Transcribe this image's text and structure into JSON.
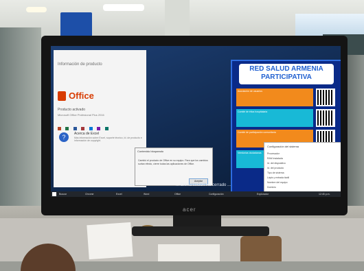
{
  "monitor": {
    "brand": "acer"
  },
  "office_window": {
    "heading": "Información de producto",
    "brand": "Office",
    "activated": "Producto activado",
    "product_name": "Microsoft Office Profesional Plus 2016",
    "about_title": "Acerca de Excel",
    "about_text": "Más información sobre Excel, soporte técnico, Id. de producto e información de copyright."
  },
  "dialog": {
    "title": "Contenido bloqueado",
    "body": "Cambió el producto de Office en su equipo. Para que los cambios surtan efecto, cierre todas las aplicaciones de Office.",
    "button": "Aceptar"
  },
  "desktop_text": "... Cierra sesión Ha cerrado ...",
  "poster": {
    "title_line1": "RED SALUD ARMENIA",
    "title_line2": "PARTICIPATIVA",
    "rows": [
      {
        "color": "#f28a1c",
        "text": "Asociación de usuarios"
      },
      {
        "color": "#18b9d6",
        "text": "Comité de ética hospitalaria"
      },
      {
        "color": "#f28a1c",
        "text": "Comité de participación comunitaria"
      },
      {
        "color": "#18b9d6",
        "text": "Veedurías ciudadanas"
      }
    ]
  },
  "info_window": {
    "title": "Configuración del sistema",
    "rows": [
      "Procesador",
      "RAM instalada",
      "Id. del dispositivo",
      "Id. del producto",
      "Tipo de sistema",
      "Lápiz y entrada táctil",
      "Nombre del equipo",
      "Dominio"
    ]
  },
  "taskbar": {
    "items": [
      "Buscar",
      "Chrome",
      "Excel",
      "Word",
      "Office",
      "Configuración",
      "Explorador"
    ],
    "clock": "12:45 p.m."
  }
}
